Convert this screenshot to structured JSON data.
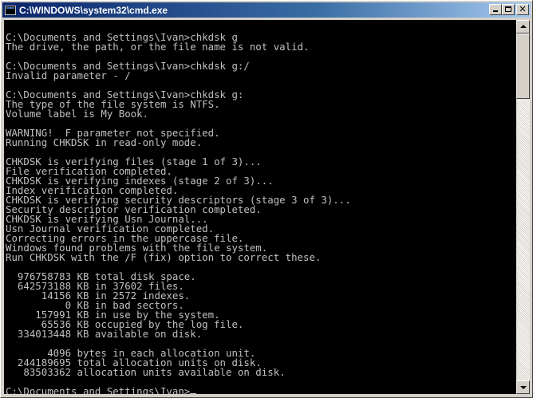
{
  "window": {
    "title": "C:\\WINDOWS\\system32\\cmd.exe",
    "icon": "console-icon",
    "buttons": {
      "minimize": "minimize-icon",
      "maximize": "maximize-icon",
      "close": "close-icon",
      "close_glyph": "✕"
    }
  },
  "console": {
    "background_color": "#000000",
    "text_color": "#c0c0c0",
    "lines": [
      "",
      "C:\\Documents and Settings\\Ivan>chkdsk g",
      "The drive, the path, or the file name is not valid.",
      "",
      "C:\\Documents and Settings\\Ivan>chkdsk g:/",
      "Invalid parameter - /",
      "",
      "C:\\Documents and Settings\\Ivan>chkdsk g:",
      "The type of the file system is NTFS.",
      "Volume label is My Book.",
      "",
      "WARNING!  F parameter not specified.",
      "Running CHKDSK in read-only mode.",
      "",
      "CHKDSK is verifying files (stage 1 of 3)...",
      "File verification completed.",
      "CHKDSK is verifying indexes (stage 2 of 3)...",
      "Index verification completed.",
      "CHKDSK is verifying security descriptors (stage 3 of 3)...",
      "Security descriptor verification completed.",
      "CHKDSK is verifying Usn Journal...",
      "Usn Journal verification completed.",
      "Correcting errors in the uppercase file.",
      "Windows found problems with the file system.",
      "Run CHKDSK with the /F (fix) option to correct these.",
      "",
      "  976758783 KB total disk space.",
      "  642573188 KB in 37602 files.",
      "      14156 KB in 2572 indexes.",
      "          0 KB in bad sectors.",
      "     157991 KB in use by the system.",
      "      65536 KB occupied by the log file.",
      "  334013448 KB available on disk.",
      "",
      "       4096 bytes in each allocation unit.",
      "  244189695 total allocation units on disk.",
      "   83503362 allocation units available on disk.",
      ""
    ],
    "prompt": "C:\\Documents and Settings\\Ivan>"
  },
  "scrollbar": {
    "up_arrow": "scroll-up-arrow-icon",
    "down_arrow": "scroll-down-arrow-icon"
  }
}
